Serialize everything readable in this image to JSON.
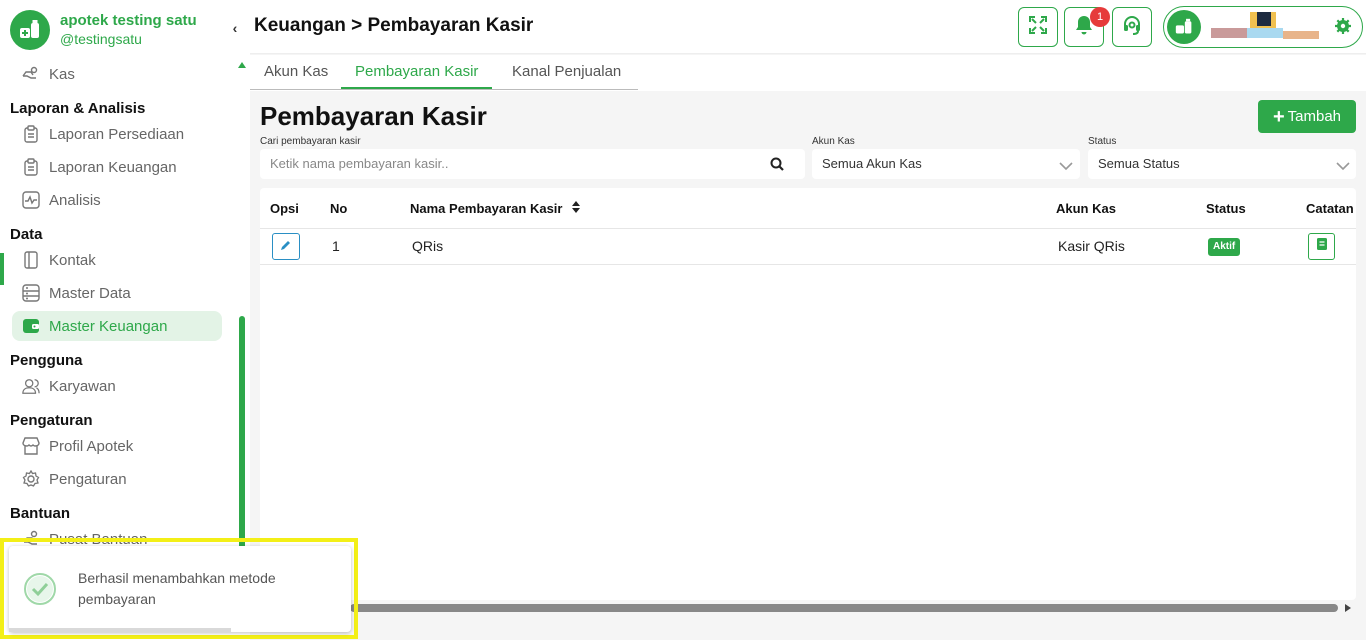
{
  "brand": {
    "name": "apotek testing satu",
    "handle": "@testingsatu"
  },
  "sidebar": {
    "items": [
      {
        "label": "Kas",
        "icon": "cash-hand-icon"
      },
      {
        "section": "Laporan & Analisis"
      },
      {
        "label": "Laporan Persediaan",
        "icon": "clipboard-icon"
      },
      {
        "label": "Laporan Keuangan",
        "icon": "clipboard-icon"
      },
      {
        "label": "Analisis",
        "icon": "chart-pulse-icon"
      },
      {
        "section": "Data"
      },
      {
        "label": "Kontak",
        "icon": "contact-book-icon"
      },
      {
        "label": "Master Data",
        "icon": "database-icon"
      },
      {
        "label": "Master Keuangan",
        "icon": "wallet-icon",
        "active": true
      },
      {
        "section": "Pengguna"
      },
      {
        "label": "Karyawan",
        "icon": "users-icon"
      },
      {
        "section": "Pengaturan"
      },
      {
        "label": "Profil Apotek",
        "icon": "store-icon"
      },
      {
        "label": "Pengaturan",
        "icon": "gear-icon"
      },
      {
        "section": "Bantuan"
      },
      {
        "label": "Pusat Bantuan",
        "icon": "help-hand-icon"
      }
    ]
  },
  "header": {
    "breadcrumb": "Keuangan > Pembayaran Kasir",
    "notification_count": "1",
    "buttons": [
      "fullscreen-icon",
      "bell-icon",
      "headset-icon"
    ]
  },
  "tabs": [
    {
      "label": "Akun Kas",
      "active": false
    },
    {
      "label": "Pembayaran Kasir",
      "active": true
    },
    {
      "label": "Kanal Penjualan",
      "active": false
    }
  ],
  "page": {
    "title": "Pembayaran Kasir",
    "add_label": "Tambah"
  },
  "filters": {
    "search_label": "Cari pembayaran kasir",
    "search_placeholder": "Ketik nama pembayaran kasir..",
    "akun_label": "Akun Kas",
    "akun_value": "Semua Akun Kas",
    "status_label": "Status",
    "status_value": "Semua Status"
  },
  "table": {
    "headers": [
      "Opsi",
      "No",
      "Nama Pembayaran Kasir",
      "Akun Kas",
      "Status",
      "Catatan"
    ],
    "rows": [
      {
        "no": "1",
        "nama": "QRis",
        "akun": "Kasir QRis",
        "status": "Aktif"
      }
    ]
  },
  "toast": {
    "message": "Berhasil menambahkan metode pembayaran"
  },
  "colors": {
    "accent": "#2ea84a",
    "danger": "#e63b3b",
    "edit": "#2a8fc4",
    "highlight": "#f3ef17"
  }
}
